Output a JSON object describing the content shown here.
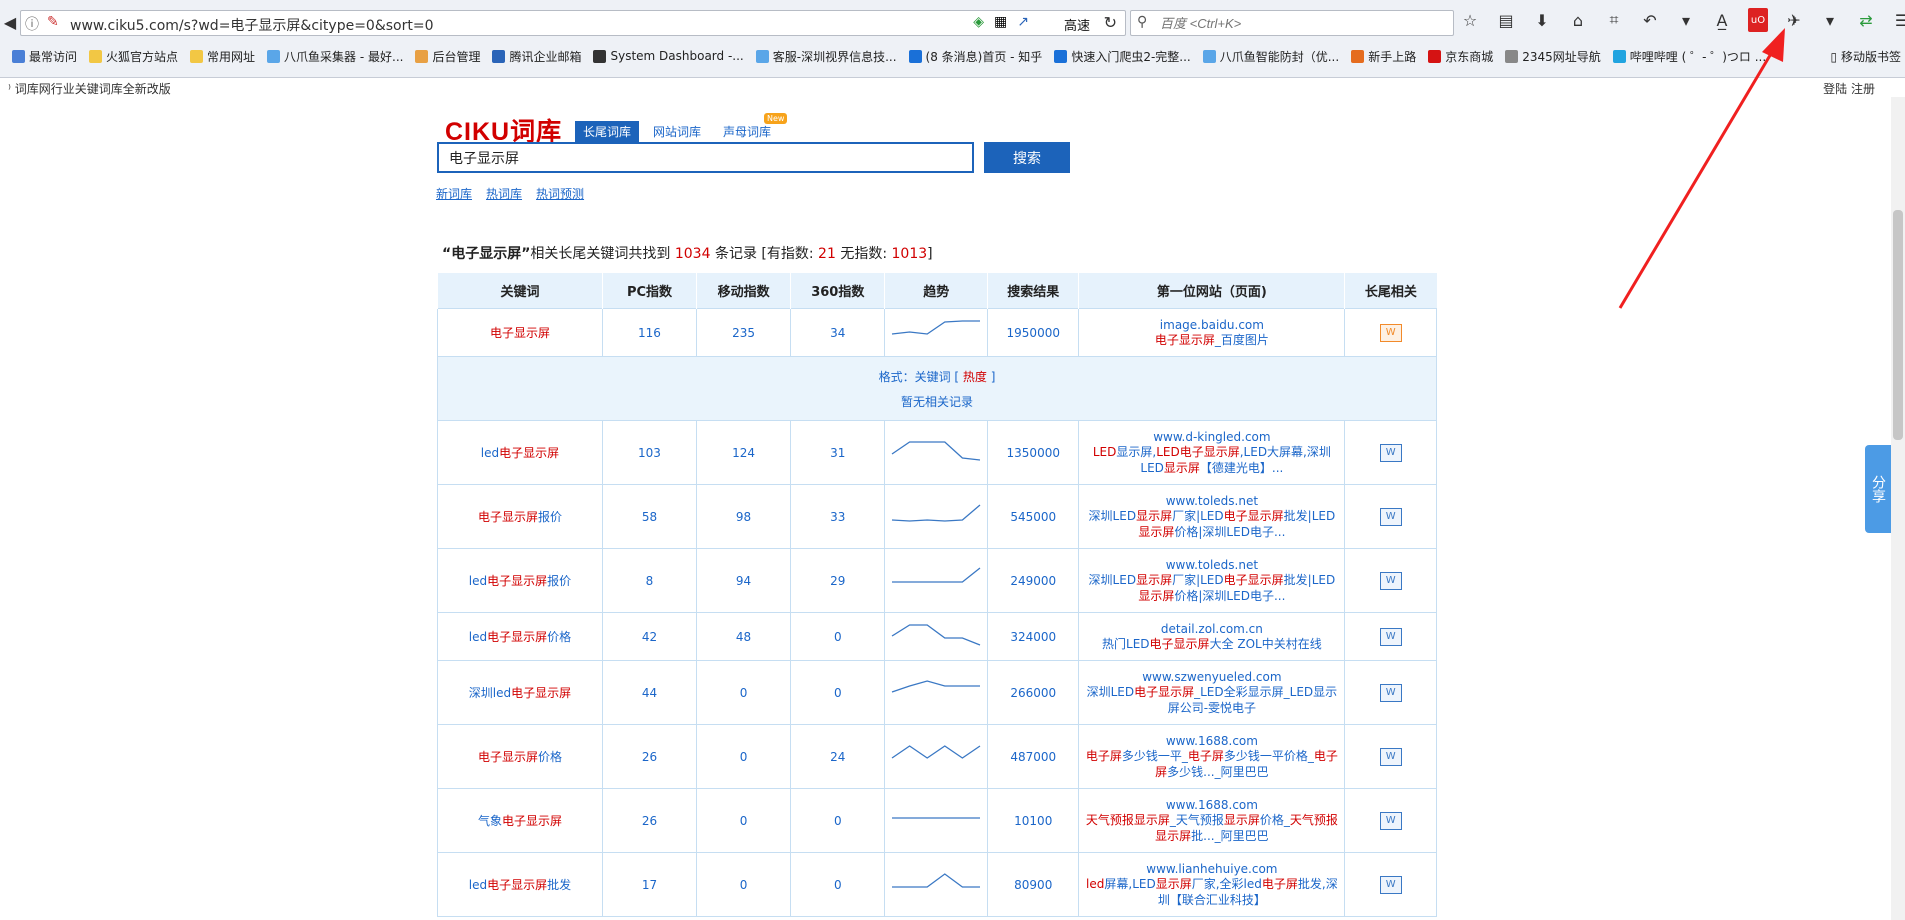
{
  "browser": {
    "url": "www.ciku5.com/s?wd=电子显示屏&citype=0&sort=0",
    "speed_label": "高速",
    "search_placeholder": "百度 <Ctrl+K>",
    "mobile_bookmarks": "移动版书签"
  },
  "bookmarks": [
    {
      "label": "最常访问",
      "color": "#4a7fd6"
    },
    {
      "label": "火狐官方站点",
      "color": "#f2c744"
    },
    {
      "label": "常用网址",
      "color": "#f2c744"
    },
    {
      "label": "八爪鱼采集器 - 最好...",
      "color": "#5aa6e8"
    },
    {
      "label": "后台管理",
      "color": "#e8a044"
    },
    {
      "label": "腾讯企业邮箱",
      "color": "#2a64b8"
    },
    {
      "label": "System Dashboard -...",
      "color": "#333333"
    },
    {
      "label": "客服-深圳视界信息技...",
      "color": "#5aa6e8"
    },
    {
      "label": "(8 条消息)首页 - 知乎",
      "color": "#1a70d8"
    },
    {
      "label": "快速入门爬虫2-完整...",
      "color": "#1a70d8"
    },
    {
      "label": "八爪鱼智能防封（优...",
      "color": "#5aa6e8"
    },
    {
      "label": "新手上路",
      "color": "#e56c1f"
    },
    {
      "label": "京东商城",
      "color": "#d51313"
    },
    {
      "label": "2345网址导航",
      "color": "#888888"
    },
    {
      "label": "哔哩哔哩 ( ゜- ゜)つロ ...",
      "color": "#21a4e0"
    }
  ],
  "page_bar": {
    "notice": "词库网行业关键词库全新改版",
    "login": "登陆 注册"
  },
  "logo": {
    "text": "CIKU",
    "cn": "词库"
  },
  "tabs": [
    "长尾词库",
    "网站词库",
    "声母词库"
  ],
  "new_badge": "New",
  "search": {
    "value": "电子显示屏",
    "button": "搜索"
  },
  "sublinks": [
    "新词库",
    "热词库",
    "热词预测"
  ],
  "summary": {
    "keyword": "“电子显示屏”",
    "text1": "相关长尾关键词共找到",
    "total": "1034",
    "text2": "条记录 [有指数:",
    "with_index": "21",
    "text3": "无指数:",
    "without_index": "1013",
    "text4": "]"
  },
  "table": {
    "headers": [
      "关键词",
      "PC指数",
      "移动指数",
      "360指数",
      "趋势",
      "搜索结果",
      "第一位网站（页面)",
      "长尾相关"
    ],
    "rows": [
      {
        "kw": [
          [
            "电子显示屏",
            true
          ]
        ],
        "pc": "116",
        "mobile": "235",
        "s360": "34",
        "trend": [
          16,
          14,
          16,
          4,
          3,
          3
        ],
        "results": "1950000",
        "domain": "image.baidu.com",
        "title": [
          [
            "电子显示屏",
            true
          ],
          [
            "_百度图片",
            false
          ]
        ],
        "icon": "orange",
        "h": 48
      },
      {
        "kw": [
          [
            "led",
            false
          ],
          [
            "电子显示屏",
            true
          ]
        ],
        "pc": "103",
        "mobile": "124",
        "s360": "31",
        "trend": [
          16,
          4,
          4,
          4,
          20,
          22
        ],
        "results": "1350000",
        "domain": "www.d-kingled.com",
        "title": [
          [
            "LED",
            true
          ],
          [
            "显示屏,",
            false
          ],
          [
            "LED电子显示屏",
            true
          ],
          [
            ",LED大屏幕,深圳LED",
            false
          ],
          [
            "显示屏",
            true
          ],
          [
            "【德建光电】...",
            false
          ]
        ],
        "icon": "blue",
        "h": 64
      },
      {
        "kw": [
          [
            "电子显示屏",
            true
          ],
          [
            "报价",
            false
          ]
        ],
        "pc": "58",
        "mobile": "98",
        "s360": "33",
        "trend": [
          18,
          19,
          18,
          19,
          18,
          3
        ],
        "results": "545000",
        "domain": "www.toleds.net",
        "title": [
          [
            "深圳LED",
            false
          ],
          [
            "显示屏",
            true
          ],
          [
            "厂家|LED",
            false
          ],
          [
            "电子显示屏",
            true
          ],
          [
            "批发|LED",
            false
          ],
          [
            "显示屏",
            true
          ],
          [
            "价格|深圳LED电子...",
            false
          ]
        ],
        "icon": "blue",
        "h": 64
      },
      {
        "kw": [
          [
            "led",
            false
          ],
          [
            "电子显示屏",
            true
          ],
          [
            "报价",
            false
          ]
        ],
        "pc": "8",
        "mobile": "94",
        "s360": "29",
        "trend": [
          16,
          16,
          16,
          16,
          16,
          2
        ],
        "results": "249000",
        "domain": "www.toleds.net",
        "title": [
          [
            "深圳LED",
            false
          ],
          [
            "显示屏",
            true
          ],
          [
            "厂家|LED",
            false
          ],
          [
            "电子显示屏",
            true
          ],
          [
            "批发|LED",
            false
          ],
          [
            "显示屏",
            true
          ],
          [
            "价格|深圳LED电子...",
            false
          ]
        ],
        "icon": "blue",
        "h": 64
      },
      {
        "kw": [
          [
            "led",
            false
          ],
          [
            "电子显示屏",
            true
          ],
          [
            "价格",
            false
          ]
        ],
        "pc": "42",
        "mobile": "48",
        "s360": "0",
        "trend": [
          14,
          3,
          3,
          16,
          16,
          23
        ],
        "results": "324000",
        "domain": "detail.zol.com.cn",
        "title": [
          [
            "热门LED",
            false
          ],
          [
            "电子显示屏",
            true
          ],
          [
            "大全 ZOL中关村在线",
            false
          ]
        ],
        "icon": "blue",
        "h": 48
      },
      {
        "kw": [
          [
            "深圳led",
            false
          ],
          [
            "电子显示屏",
            true
          ]
        ],
        "pc": "44",
        "mobile": "0",
        "s360": "0",
        "trend": [
          14,
          8,
          3,
          8,
          8,
          8
        ],
        "results": "266000",
        "domain": "www.szwenyueled.com",
        "title": [
          [
            "深圳LED",
            false
          ],
          [
            "电子显示屏",
            true
          ],
          [
            "_LED全彩显示屏_LED显示屏公司-雯悦电子",
            false
          ]
        ],
        "icon": "blue",
        "h": 64
      },
      {
        "kw": [
          [
            "电子显示屏",
            true
          ],
          [
            "价格",
            false
          ]
        ],
        "pc": "26",
        "mobile": "0",
        "s360": "24",
        "trend": [
          16,
          4,
          16,
          4,
          16,
          4
        ],
        "results": "487000",
        "domain": "www.1688.com",
        "title": [
          [
            "电子屏",
            true
          ],
          [
            "多少钱一平_",
            false
          ],
          [
            "电子屏",
            true
          ],
          [
            "多少钱一平价格_",
            false
          ],
          [
            "电子屏",
            true
          ],
          [
            "多少钱..._阿里巴巴",
            false
          ]
        ],
        "icon": "blue",
        "h": 64
      },
      {
        "kw": [
          [
            "气象",
            false
          ],
          [
            "电子显示屏",
            true
          ]
        ],
        "pc": "26",
        "mobile": "0",
        "s360": "0",
        "trend": [
          12,
          12,
          12,
          12,
          12,
          12
        ],
        "results": "10100",
        "domain": "www.1688.com",
        "title": [
          [
            "天气预报",
            true
          ],
          [
            "显示屏",
            true
          ],
          [
            "_天气预报",
            false
          ],
          [
            "显示屏",
            true
          ],
          [
            "价格_",
            false
          ],
          [
            "天气预报",
            true
          ],
          [
            "显示屏",
            true
          ],
          [
            "批..._阿里巴巴",
            false
          ]
        ],
        "icon": "blue",
        "h": 64
      },
      {
        "kw": [
          [
            "led",
            false
          ],
          [
            "电子显示屏",
            true
          ],
          [
            "批发",
            false
          ]
        ],
        "pc": "17",
        "mobile": "0",
        "s360": "0",
        "trend": [
          17,
          17,
          17,
          4,
          17,
          17
        ],
        "results": "80900",
        "domain": "www.lianhehuiye.com",
        "title": [
          [
            "led",
            true
          ],
          [
            "屏幕,LED",
            false
          ],
          [
            "显示屏",
            true
          ],
          [
            "厂家,全彩led",
            false
          ],
          [
            "电子屏",
            true
          ],
          [
            "批发,深圳【联合汇业科技】",
            false
          ]
        ],
        "icon": "blue",
        "h": 64
      }
    ],
    "sub_row": {
      "format_label": "格式：",
      "format_kw": "关键词",
      "format_heat": "热度",
      "empty": "暂无相关记录"
    }
  },
  "share": "分享"
}
